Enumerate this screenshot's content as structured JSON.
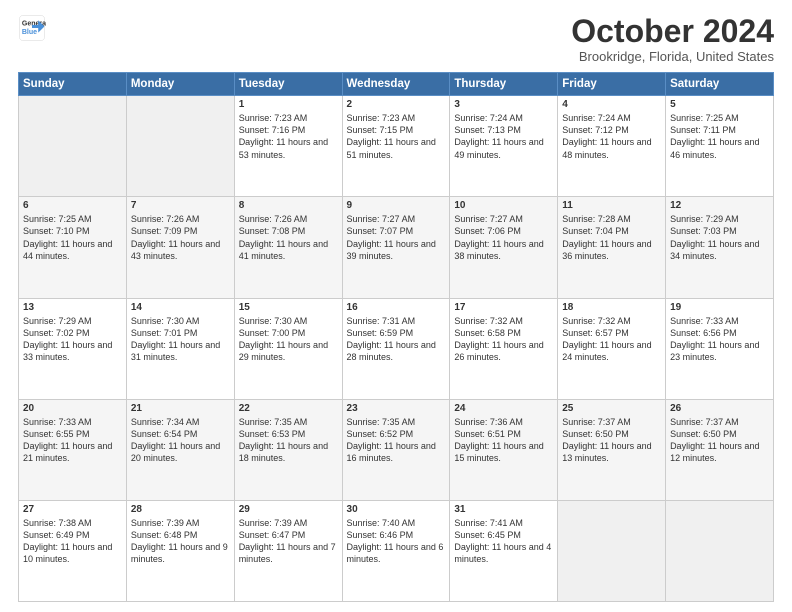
{
  "logo": {
    "line1": "General",
    "line2": "Blue"
  },
  "title": "October 2024",
  "subtitle": "Brookridge, Florida, United States",
  "weekdays": [
    "Sunday",
    "Monday",
    "Tuesday",
    "Wednesday",
    "Thursday",
    "Friday",
    "Saturday"
  ],
  "weeks": [
    [
      {
        "day": "",
        "sunrise": "",
        "sunset": "",
        "daylight": ""
      },
      {
        "day": "",
        "sunrise": "",
        "sunset": "",
        "daylight": ""
      },
      {
        "day": "1",
        "sunrise": "Sunrise: 7:23 AM",
        "sunset": "Sunset: 7:16 PM",
        "daylight": "Daylight: 11 hours and 53 minutes."
      },
      {
        "day": "2",
        "sunrise": "Sunrise: 7:23 AM",
        "sunset": "Sunset: 7:15 PM",
        "daylight": "Daylight: 11 hours and 51 minutes."
      },
      {
        "day": "3",
        "sunrise": "Sunrise: 7:24 AM",
        "sunset": "Sunset: 7:13 PM",
        "daylight": "Daylight: 11 hours and 49 minutes."
      },
      {
        "day": "4",
        "sunrise": "Sunrise: 7:24 AM",
        "sunset": "Sunset: 7:12 PM",
        "daylight": "Daylight: 11 hours and 48 minutes."
      },
      {
        "day": "5",
        "sunrise": "Sunrise: 7:25 AM",
        "sunset": "Sunset: 7:11 PM",
        "daylight": "Daylight: 11 hours and 46 minutes."
      }
    ],
    [
      {
        "day": "6",
        "sunrise": "Sunrise: 7:25 AM",
        "sunset": "Sunset: 7:10 PM",
        "daylight": "Daylight: 11 hours and 44 minutes."
      },
      {
        "day": "7",
        "sunrise": "Sunrise: 7:26 AM",
        "sunset": "Sunset: 7:09 PM",
        "daylight": "Daylight: 11 hours and 43 minutes."
      },
      {
        "day": "8",
        "sunrise": "Sunrise: 7:26 AM",
        "sunset": "Sunset: 7:08 PM",
        "daylight": "Daylight: 11 hours and 41 minutes."
      },
      {
        "day": "9",
        "sunrise": "Sunrise: 7:27 AM",
        "sunset": "Sunset: 7:07 PM",
        "daylight": "Daylight: 11 hours and 39 minutes."
      },
      {
        "day": "10",
        "sunrise": "Sunrise: 7:27 AM",
        "sunset": "Sunset: 7:06 PM",
        "daylight": "Daylight: 11 hours and 38 minutes."
      },
      {
        "day": "11",
        "sunrise": "Sunrise: 7:28 AM",
        "sunset": "Sunset: 7:04 PM",
        "daylight": "Daylight: 11 hours and 36 minutes."
      },
      {
        "day": "12",
        "sunrise": "Sunrise: 7:29 AM",
        "sunset": "Sunset: 7:03 PM",
        "daylight": "Daylight: 11 hours and 34 minutes."
      }
    ],
    [
      {
        "day": "13",
        "sunrise": "Sunrise: 7:29 AM",
        "sunset": "Sunset: 7:02 PM",
        "daylight": "Daylight: 11 hours and 33 minutes."
      },
      {
        "day": "14",
        "sunrise": "Sunrise: 7:30 AM",
        "sunset": "Sunset: 7:01 PM",
        "daylight": "Daylight: 11 hours and 31 minutes."
      },
      {
        "day": "15",
        "sunrise": "Sunrise: 7:30 AM",
        "sunset": "Sunset: 7:00 PM",
        "daylight": "Daylight: 11 hours and 29 minutes."
      },
      {
        "day": "16",
        "sunrise": "Sunrise: 7:31 AM",
        "sunset": "Sunset: 6:59 PM",
        "daylight": "Daylight: 11 hours and 28 minutes."
      },
      {
        "day": "17",
        "sunrise": "Sunrise: 7:32 AM",
        "sunset": "Sunset: 6:58 PM",
        "daylight": "Daylight: 11 hours and 26 minutes."
      },
      {
        "day": "18",
        "sunrise": "Sunrise: 7:32 AM",
        "sunset": "Sunset: 6:57 PM",
        "daylight": "Daylight: 11 hours and 24 minutes."
      },
      {
        "day": "19",
        "sunrise": "Sunrise: 7:33 AM",
        "sunset": "Sunset: 6:56 PM",
        "daylight": "Daylight: 11 hours and 23 minutes."
      }
    ],
    [
      {
        "day": "20",
        "sunrise": "Sunrise: 7:33 AM",
        "sunset": "Sunset: 6:55 PM",
        "daylight": "Daylight: 11 hours and 21 minutes."
      },
      {
        "day": "21",
        "sunrise": "Sunrise: 7:34 AM",
        "sunset": "Sunset: 6:54 PM",
        "daylight": "Daylight: 11 hours and 20 minutes."
      },
      {
        "day": "22",
        "sunrise": "Sunrise: 7:35 AM",
        "sunset": "Sunset: 6:53 PM",
        "daylight": "Daylight: 11 hours and 18 minutes."
      },
      {
        "day": "23",
        "sunrise": "Sunrise: 7:35 AM",
        "sunset": "Sunset: 6:52 PM",
        "daylight": "Daylight: 11 hours and 16 minutes."
      },
      {
        "day": "24",
        "sunrise": "Sunrise: 7:36 AM",
        "sunset": "Sunset: 6:51 PM",
        "daylight": "Daylight: 11 hours and 15 minutes."
      },
      {
        "day": "25",
        "sunrise": "Sunrise: 7:37 AM",
        "sunset": "Sunset: 6:50 PM",
        "daylight": "Daylight: 11 hours and 13 minutes."
      },
      {
        "day": "26",
        "sunrise": "Sunrise: 7:37 AM",
        "sunset": "Sunset: 6:50 PM",
        "daylight": "Daylight: 11 hours and 12 minutes."
      }
    ],
    [
      {
        "day": "27",
        "sunrise": "Sunrise: 7:38 AM",
        "sunset": "Sunset: 6:49 PM",
        "daylight": "Daylight: 11 hours and 10 minutes."
      },
      {
        "day": "28",
        "sunrise": "Sunrise: 7:39 AM",
        "sunset": "Sunset: 6:48 PM",
        "daylight": "Daylight: 11 hours and 9 minutes."
      },
      {
        "day": "29",
        "sunrise": "Sunrise: 7:39 AM",
        "sunset": "Sunset: 6:47 PM",
        "daylight": "Daylight: 11 hours and 7 minutes."
      },
      {
        "day": "30",
        "sunrise": "Sunrise: 7:40 AM",
        "sunset": "Sunset: 6:46 PM",
        "daylight": "Daylight: 11 hours and 6 minutes."
      },
      {
        "day": "31",
        "sunrise": "Sunrise: 7:41 AM",
        "sunset": "Sunset: 6:45 PM",
        "daylight": "Daylight: 11 hours and 4 minutes."
      },
      {
        "day": "",
        "sunrise": "",
        "sunset": "",
        "daylight": ""
      },
      {
        "day": "",
        "sunrise": "",
        "sunset": "",
        "daylight": ""
      }
    ]
  ]
}
